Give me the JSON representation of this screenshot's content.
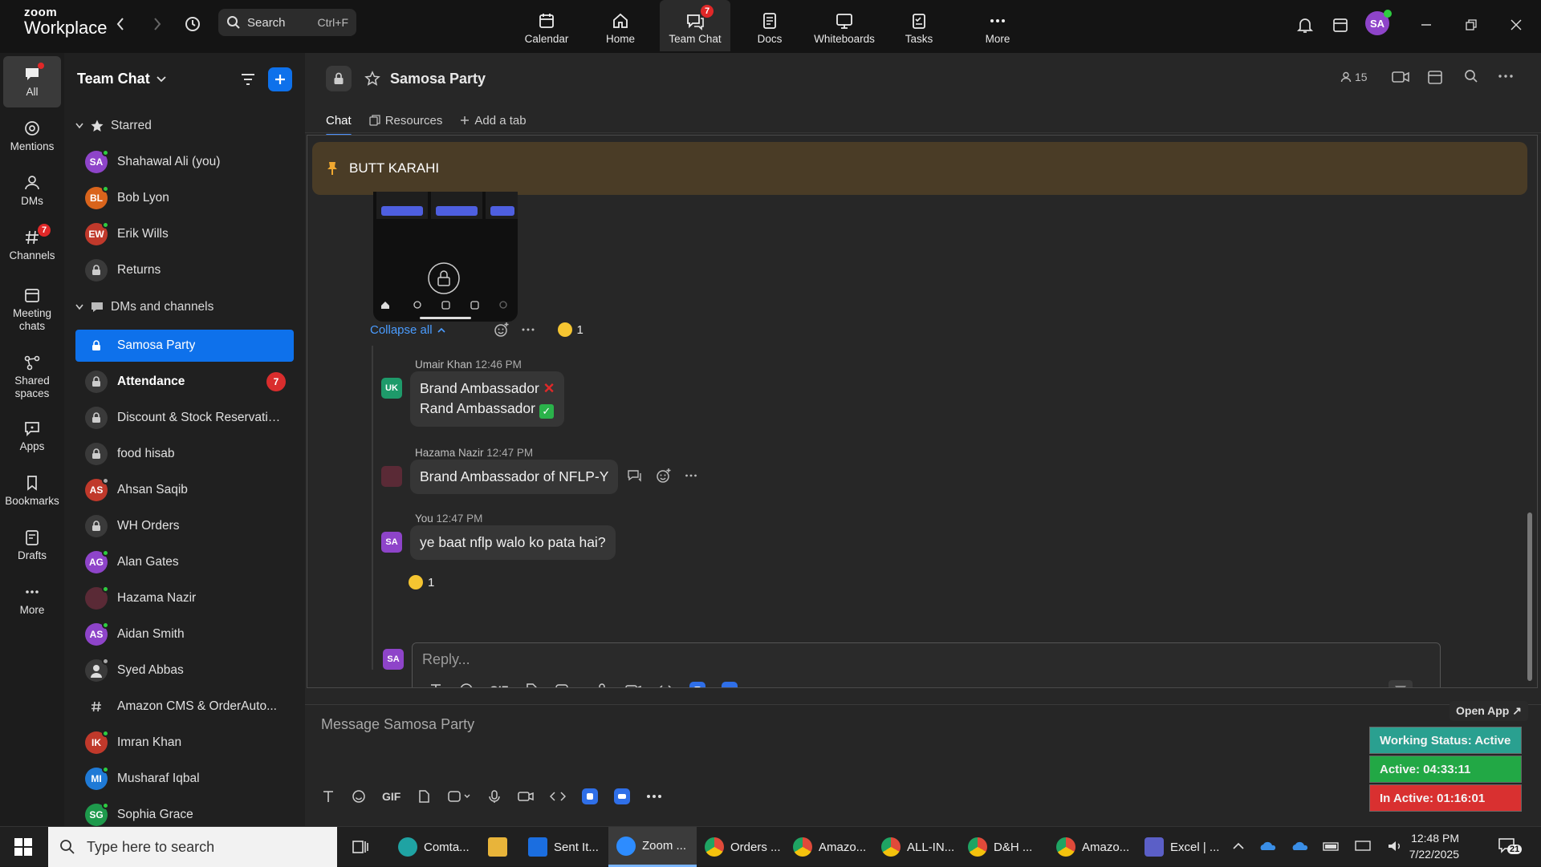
{
  "topbar": {
    "logo_line1": "zoom",
    "logo_line2": "Workplace",
    "search_label": "Search",
    "search_shortcut": "Ctrl+F",
    "nav": [
      {
        "label": "Calendar"
      },
      {
        "label": "Home"
      },
      {
        "label": "Team Chat",
        "badge": "7"
      },
      {
        "label": "Docs"
      },
      {
        "label": "Whiteboards"
      },
      {
        "label": "Tasks"
      },
      {
        "label": "More"
      }
    ],
    "user_initials": "SA"
  },
  "rail": [
    {
      "label": "All"
    },
    {
      "label": "Mentions"
    },
    {
      "label": "DMs"
    },
    {
      "label": "Channels",
      "badge": "7"
    },
    {
      "label": "Meeting chats"
    },
    {
      "label": "Shared spaces"
    },
    {
      "label": "Apps"
    },
    {
      "label": "Bookmarks"
    },
    {
      "label": "Drafts"
    },
    {
      "label": "More"
    }
  ],
  "sidebar": {
    "title": "Team Chat",
    "starred_label": "Starred",
    "dms_label": "DMs and channels",
    "starred": [
      {
        "initials": "SA",
        "name": "Shahawal Ali (you)",
        "color": "#8e44c9",
        "status": "#2ecc40"
      },
      {
        "initials": "BL",
        "name": "Bob Lyon",
        "color": "#d9641c",
        "status": "#2ecc40"
      },
      {
        "initials": "EW",
        "name": "Erik Wills",
        "color": "#c0392b",
        "status": "#2ecc40"
      },
      {
        "initials": "",
        "name": "Returns",
        "lock": true
      }
    ],
    "items": [
      {
        "name": "Samosa Party",
        "lock": true,
        "selected": true
      },
      {
        "name": "Attendance",
        "lock": true,
        "bold": true,
        "count": "7"
      },
      {
        "name": "Discount & Stock Reservatio...",
        "lock": true
      },
      {
        "name": "food hisab",
        "lock": true
      },
      {
        "initials": "AS",
        "name": "Ahsan Saqib",
        "color": "#c0392b",
        "status": "#aaaaaa"
      },
      {
        "name": "WH Orders",
        "lock": true
      },
      {
        "initials": "AG",
        "name": "Alan Gates",
        "color": "#8e44c9",
        "status": "#2ecc40"
      },
      {
        "initials": "",
        "name": "Hazama Nazir",
        "color": "#5a2a36",
        "status": "#2ecc40"
      },
      {
        "initials": "AS",
        "name": "Aidan Smith",
        "color": "#8e44c9",
        "status": "#2ecc40"
      },
      {
        "initials": "",
        "name": "Syed Abbas",
        "color": "#3a3a3a",
        "status": "#aaaaaa"
      },
      {
        "name": "Amazon CMS & OrderAuto...",
        "hash": true
      },
      {
        "initials": "IK",
        "name": "Imran Khan",
        "color": "#c0392b",
        "status": "#2ecc40"
      },
      {
        "initials": "MI",
        "name": "Musharaf Iqbal",
        "color": "#1f7ad6",
        "status": "#2ecc40"
      },
      {
        "initials": "SG",
        "name": "Sophia Grace",
        "color": "#1e9a4c",
        "status": "#2ecc40"
      }
    ]
  },
  "channel": {
    "name": "Samosa Party",
    "member_count": "15",
    "tabs": [
      {
        "label": "Chat"
      },
      {
        "label": "Resources"
      },
      {
        "label": "Add a tab"
      }
    ],
    "pinned": "BUTT KARAHI",
    "collapse_label": "Collapse all",
    "parent_reaction_count": "1",
    "messages": [
      {
        "author": "Umair Khan",
        "time": "12:46 PM",
        "initials": "UK",
        "color": "#1e9a6a",
        "lines": [
          "Brand Ambassador",
          "Rand Ambassador"
        ]
      },
      {
        "author": "Hazama Nazir",
        "time": "12:47 PM",
        "initials": "",
        "color": "#5a2a36",
        "lines": [
          "Brand Ambassador of NFLP-Y"
        ]
      },
      {
        "author": "You",
        "time": "12:47 PM",
        "initials": "SA",
        "color": "#8e44c9",
        "lines": [
          "ye baat nflp walo ko pata hai?"
        ],
        "reaction_count": "1"
      }
    ],
    "reply_placeholder": "Reply...",
    "message_placeholder": "Message Samosa Party",
    "gif_label": "GIF"
  },
  "status_widget": {
    "open_app": "Open App ↗",
    "working_status": "Working Status: Active",
    "active": "Active: 04:33:11",
    "inactive": "In Active: 01:16:01",
    "colors": {
      "working": "#2aa090",
      "active": "#22a845",
      "inactive": "#d93030"
    }
  },
  "taskbar": {
    "search_placeholder": "Type here to search",
    "apps": [
      {
        "label": "Comta...",
        "color": "#1fa3a3"
      },
      {
        "label": "",
        "color": "#e8b43a"
      },
      {
        "label": "Sent It...",
        "color": "#1b6ee0"
      },
      {
        "label": "Zoom ...",
        "color": "#2d8cff"
      },
      {
        "label": "Orders ...",
        "color": "#e04a3a"
      },
      {
        "label": "Amazo...",
        "color": "#e04a3a"
      },
      {
        "label": "ALL-IN...",
        "color": "#e04a3a"
      },
      {
        "label": "D&H ...",
        "color": "#e04a3a"
      },
      {
        "label": "Amazo...",
        "color": "#e04a3a"
      },
      {
        "label": "Excel | ...",
        "color": "#5b5fc7"
      }
    ],
    "time": "12:48 PM",
    "date": "7/22/2025",
    "notif_count": "21"
  }
}
